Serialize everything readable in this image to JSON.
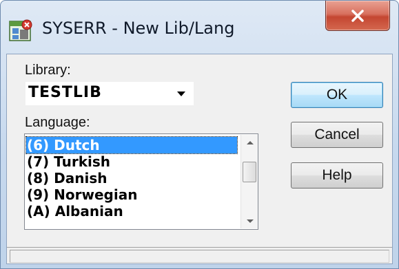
{
  "window": {
    "title": "SYSERR - New Lib/Lang",
    "icon": "app-icon",
    "close_icon": "close-icon"
  },
  "library": {
    "label": "Library:",
    "value": "TESTLIB"
  },
  "language": {
    "label": "Language:",
    "items": [
      "(6) Dutch",
      "(7) Turkish",
      "(8) Danish",
      "(9) Norwegian",
      "(A) Albanian"
    ],
    "selected": "(6) Dutch"
  },
  "buttons": {
    "ok": "OK",
    "cancel": "Cancel",
    "help": "Help"
  },
  "colors": {
    "selection": "#3399ff",
    "close_button": "#c44631"
  }
}
